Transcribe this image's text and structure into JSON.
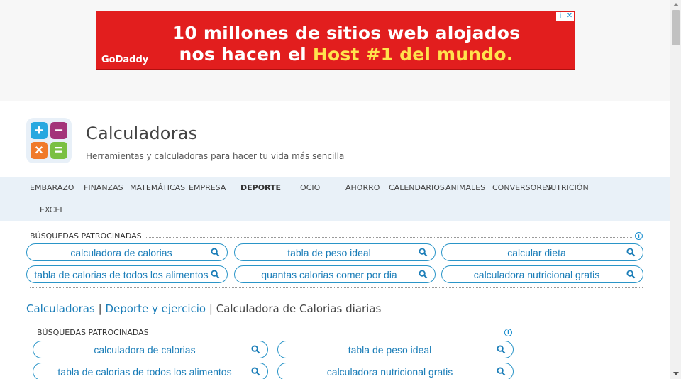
{
  "ad": {
    "line1": "10 millones de sitios web alojados",
    "line2_prefix": "nos hacen el ",
    "line2_highlight": "Host #1 del mundo.",
    "logo": "GoDaddy",
    "info_glyph": "i",
    "close_glyph": "✕",
    "bg_color": "#e21e1e",
    "highlight_color": "#ffe34d"
  },
  "site": {
    "title": "Calculadoras",
    "subtitle": "Herramientas y calculadoras para hacer tu vida más sencilla",
    "logo_glyphs": [
      "+",
      "−",
      "×",
      "="
    ]
  },
  "nav": {
    "items": [
      "EMBARAZO",
      "FINANZAS",
      "MATEMÁTICAS",
      "EMPRESA",
      "DEPORTE",
      "OCIO",
      "AHORRO",
      "CALENDARIOS",
      "ANIMALES",
      "CONVERSORES",
      "NUTRICIÓN",
      "EXCEL"
    ],
    "active": "DEPORTE"
  },
  "sponsored1": {
    "heading": "BÚSQUEDAS PATROCINADAS",
    "pills": [
      "calculadora de calorias",
      "tabla de peso ideal",
      "calcular dieta",
      "tabla de calorias de todos los alimentos",
      "quantas calorias comer por dia",
      "calculadora nutricional gratis"
    ]
  },
  "breadcrumb": {
    "items": [
      "Calculadoras",
      "Deporte y ejercicio"
    ],
    "separator": "|",
    "current": "Calculadora de Calorias diarias"
  },
  "sponsored2": {
    "heading": "BÚSQUEDAS PATROCINADAS",
    "pills": [
      "calculadora de calorias",
      "tabla de peso ideal",
      "tabla de calorias de todos los alimentos",
      "calculadora nutricional gratis"
    ]
  },
  "colors": {
    "accent": "#1a7db8",
    "nav_bg": "#e9f1f8"
  }
}
